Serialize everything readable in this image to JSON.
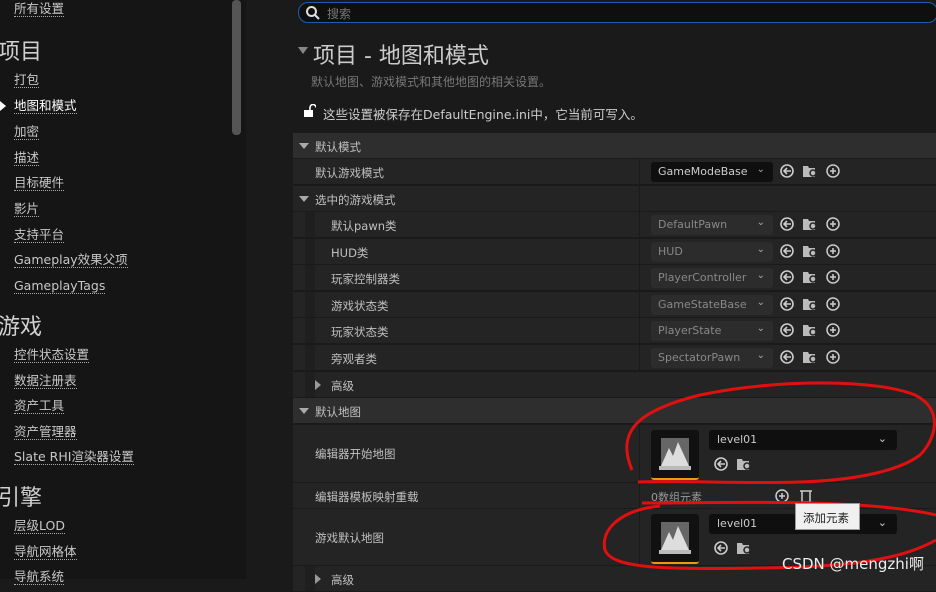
{
  "sidebar": {
    "top_item": "所有设置",
    "categories": [
      {
        "title": "项目",
        "items": [
          "打包",
          "地图和模式",
          "加密",
          "描述",
          "目标硬件",
          "影片",
          "支持平台",
          "Gameplay效果父项",
          "GameplayTags"
        ]
      },
      {
        "title": "游戏",
        "items": [
          "控件状态设置",
          "数据注册表",
          "资产工具",
          "资产管理器",
          "Slate RHI渲染器设置"
        ]
      },
      {
        "title": "引擎",
        "items": [
          "层级LOD",
          "导航网格体",
          "导航系统"
        ]
      }
    ],
    "selected": "地图和模式"
  },
  "search": {
    "placeholder": "搜索"
  },
  "page": {
    "title": "项目 - 地图和模式",
    "description": "默认地图、游戏模式和其他地图的相关设置。",
    "notice": "这些设置被保存在DefaultEngine.ini中，它当前可写入。"
  },
  "sections": {
    "default_modes": {
      "label": "默认模式",
      "default_game_mode": {
        "label": "默认游戏模式",
        "value": "GameModeBase"
      }
    },
    "selected_mode": {
      "label": "选中的游戏模式",
      "rows": [
        {
          "label": "默认pawn类",
          "value": "DefaultPawn"
        },
        {
          "label": "HUD类",
          "value": "HUD"
        },
        {
          "label": "玩家控制器类",
          "value": "PlayerController"
        },
        {
          "label": "游戏状态类",
          "value": "GameStateBase"
        },
        {
          "label": "玩家状态类",
          "value": "PlayerState"
        },
        {
          "label": "旁观者类",
          "value": "SpectatorPawn"
        }
      ],
      "advanced": "高级"
    },
    "default_maps": {
      "label": "默认地图",
      "editor_startup": {
        "label": "编辑器开始地图",
        "value": "level01"
      },
      "template_override": {
        "label": "编辑器模板映射重载",
        "value": "0数组元素"
      },
      "game_default": {
        "label": "游戏默认地图",
        "value": "level01"
      },
      "advanced": "高级"
    }
  },
  "tooltip": "添加元素",
  "watermark": "CSDN @mengzhi啊",
  "colors": {
    "accent": "#1b5fb0",
    "annotation": "#e01010",
    "map_underline": "#e89a10"
  }
}
